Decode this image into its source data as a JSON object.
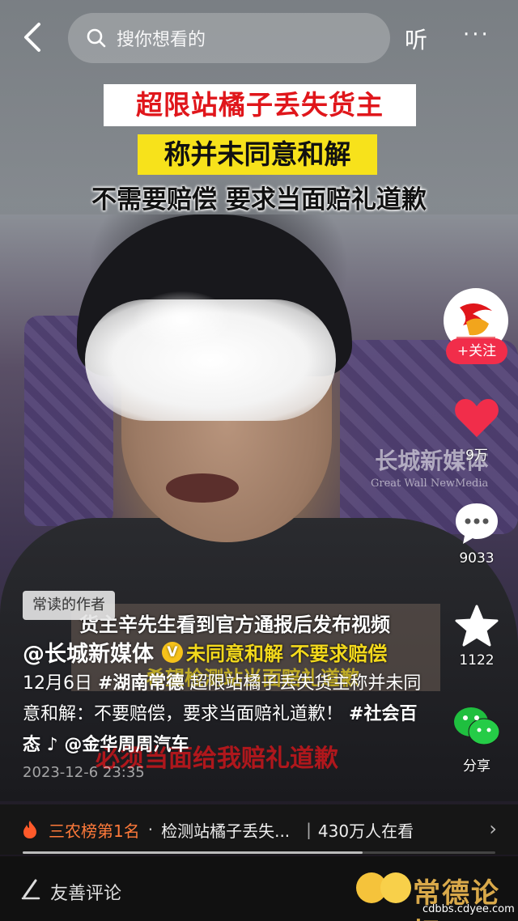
{
  "header": {
    "search_placeholder": "搜你想看的",
    "listen_label": "听",
    "more_label": "···"
  },
  "video": {
    "banner_line1": "超限站橘子丢失货主",
    "banner_line2": "称并未同意和解",
    "banner_line3": "不需要赔偿 要求当面赔礼道歉",
    "watermark_cn": "长城新媒体",
    "watermark_en": "Great Wall NewMedia",
    "subtitle1": "货主辛先生看到官方通报后发布视频",
    "subtitle2": "未同意和解 不要求赔偿",
    "subtitle3": "希望检测站当面赔礼道歉",
    "subtitle4": "必须当面给我赔礼道歉"
  },
  "sidebar": {
    "follow_label": "+关注",
    "likes": "9万",
    "comments": "9033",
    "favorites": "1122",
    "share_label": "分享"
  },
  "post": {
    "tag": "常读的作者",
    "author": "@长城新媒体",
    "verified_mark": "V",
    "caption_date": "12月6日 ",
    "caption_tag1": "#湖南常德",
    "caption_text": " 超限站橘子丢失货主称并未同意和解：不要赔偿，要求当面赔礼道歉！",
    "caption_tag2": "#社会百态",
    "caption_music": " ♪ @金华周周汽车",
    "timestamp": "2023-12-6 23:35"
  },
  "hot": {
    "rank": "三农榜第1名",
    "dot": "·",
    "title": "检测站橘子丢失...",
    "sep": "|",
    "views": "430万人在看",
    "arrow": "›",
    "progress": 0.72
  },
  "bottom": {
    "comment_placeholder": "友善评论",
    "site_mark": "常德论坛",
    "site_url": "cdbbs.cdyee.com"
  },
  "colors": {
    "follow": "#f12d4a",
    "like": "#f12d4a",
    "hot_rank": "#ff7a3a",
    "banner_red": "#e0161b",
    "banner_yellow": "#f7e21b"
  }
}
